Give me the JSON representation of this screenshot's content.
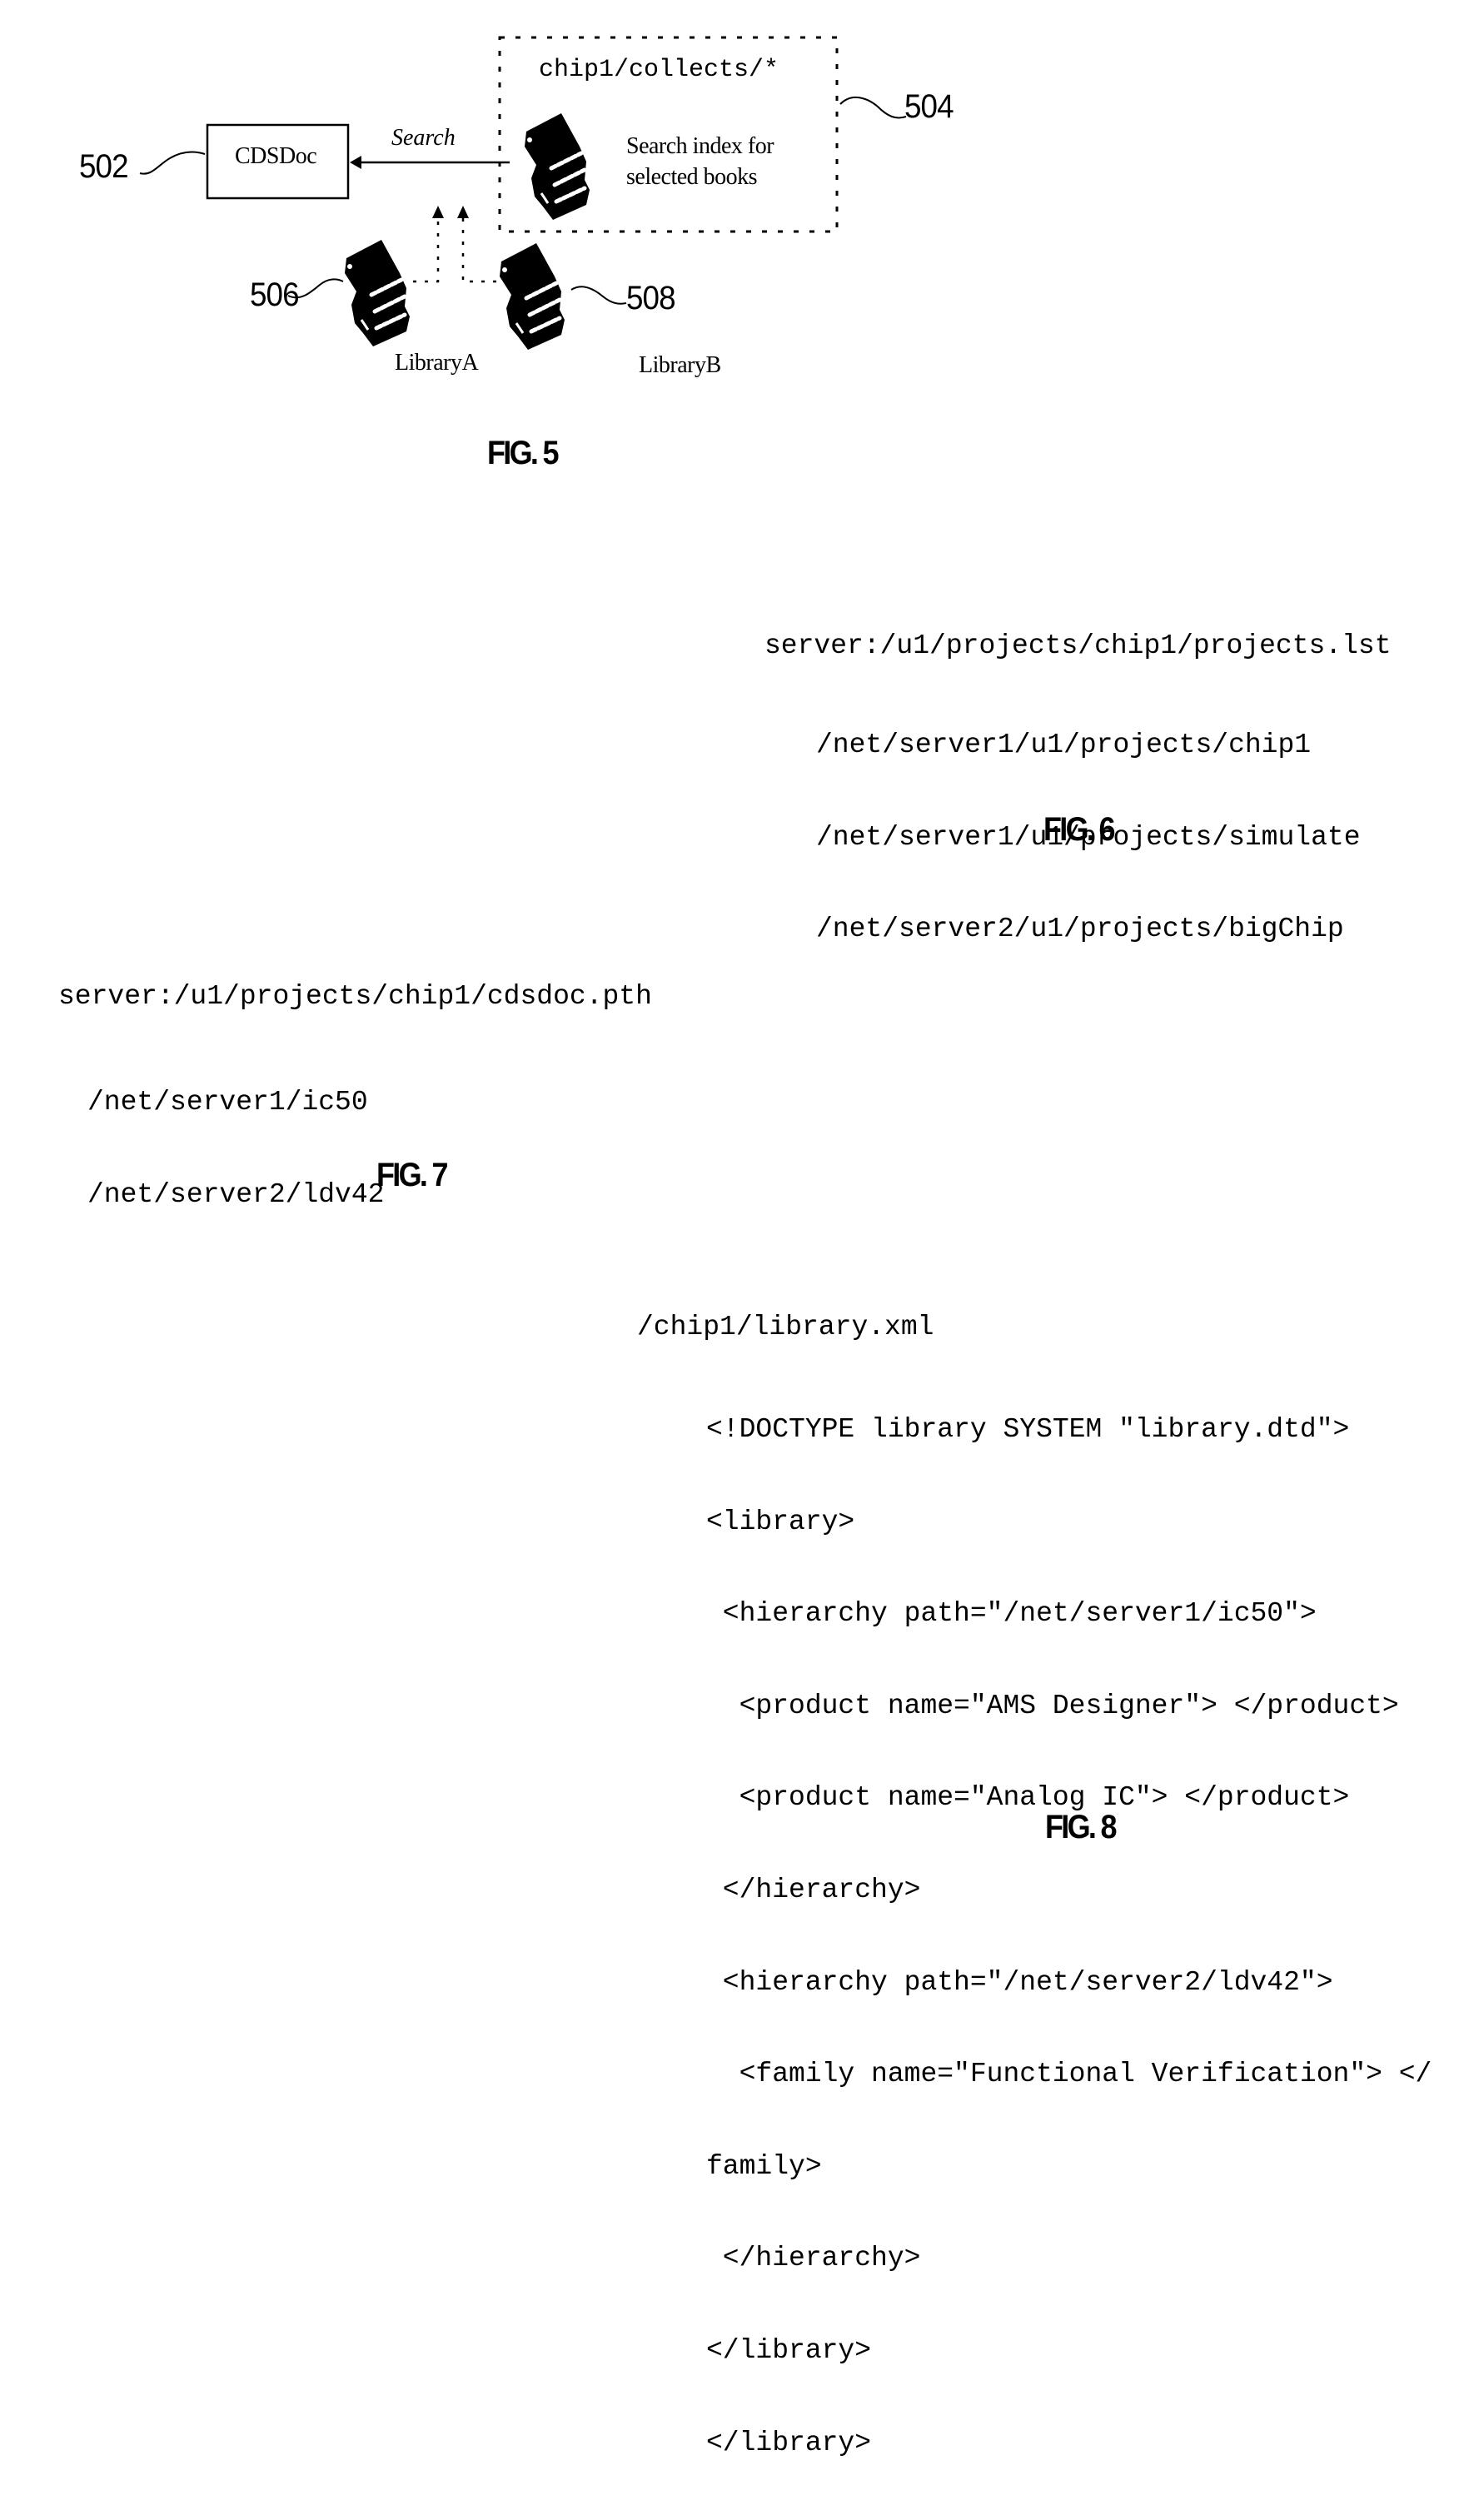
{
  "fig5": {
    "label": "FIG. 5",
    "collection_path": "chip1/collects/*",
    "index_caption_line1": "Search index for",
    "index_caption_line2": "selected books",
    "cdsdoc_label": "CDSDoc",
    "search_arrow_label": "Search",
    "library_a_label": "LibraryA",
    "library_b_label": "LibraryB",
    "ref_cdsdoc": "502",
    "ref_index": "504",
    "ref_library_a": "506",
    "ref_library_b": "508",
    "icons": {
      "index_books": "books-stack-icon",
      "library_a_books": "books-stack-icon",
      "library_b_books": "books-stack-icon"
    }
  },
  "fig6": {
    "label": "FIG. 6",
    "file_path": "server:/u1/projects/chip1/projects.lst",
    "entries": [
      "/net/server1/u1/projects/chip1",
      "/net/server1/u1/projects/simulate",
      "/net/server2/u1/projects/bigChip"
    ]
  },
  "fig7": {
    "label": "FIG. 7",
    "file_path": "server:/u1/projects/chip1/cdsdoc.pth",
    "entries": [
      "/net/server1/ic50",
      "/net/server2/ldv42"
    ]
  },
  "fig8": {
    "label": "FIG. 8",
    "file_path": "/chip1/library.xml",
    "xml_lines": [
      "<!DOCTYPE library SYSTEM \"library.dtd\">",
      "<library>",
      " <hierarchy path=\"/net/server1/ic50\">",
      "  <product name=\"AMS Designer\"> </product>",
      "  <product name=\"Analog IC\"> </product>",
      " </hierarchy>",
      " <hierarchy path=\"/net/server2/ldv42\">",
      "  <family name=\"Functional Verification\"> </",
      "family>",
      " </hierarchy>",
      "</library>",
      "</library>"
    ]
  }
}
